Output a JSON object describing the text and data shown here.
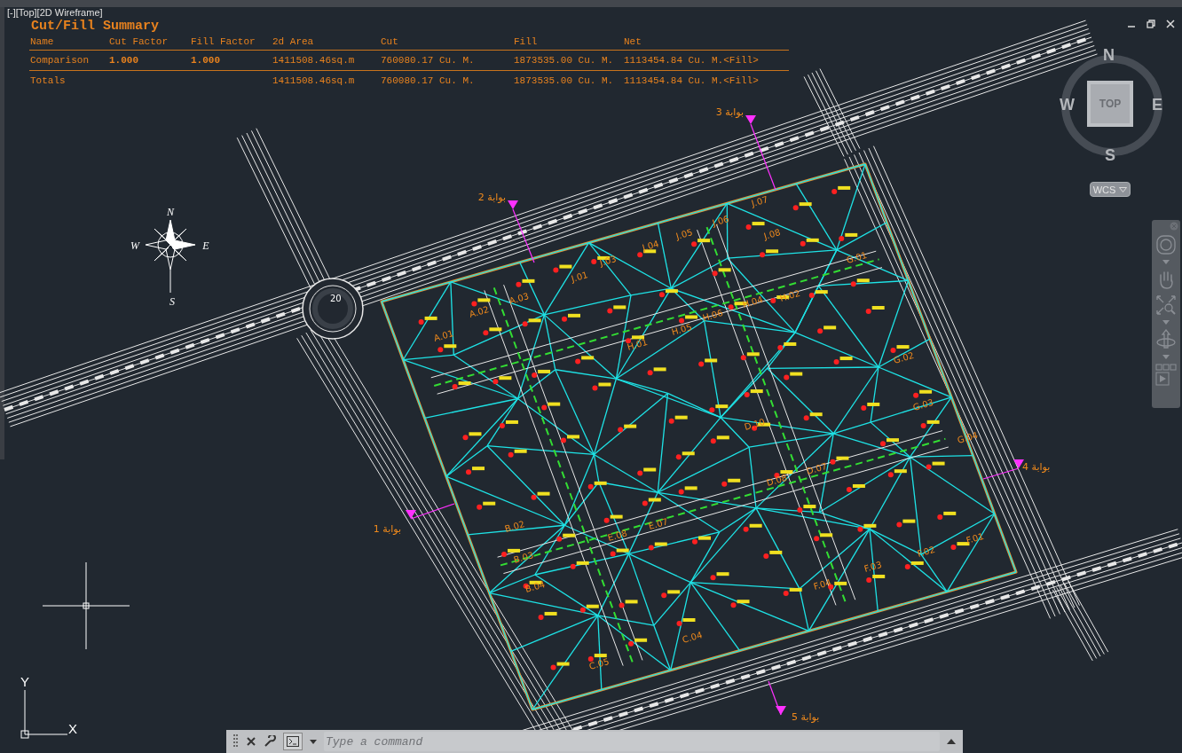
{
  "viewport_label": "[-][Top][2D Wireframe]",
  "summary": {
    "title": "Cut/Fill Summary",
    "columns": [
      "Name",
      "Cut Factor",
      "Fill Factor",
      "2d Area",
      "Cut",
      "Fill",
      "Net"
    ],
    "rows": [
      {
        "name": "Comparison",
        "cut_factor": "1.000",
        "fill_factor": "1.000",
        "area": "1411508.46sq.m",
        "cut": "760080.17 Cu. M.",
        "fill": "1873535.00 Cu. M.",
        "net": "1113454.84 Cu. M.<Fill>"
      },
      {
        "name": "Totals",
        "area": "1411508.46sq.m",
        "cut": "760080.17 Cu. M.",
        "fill": "1873535.00 Cu. M.",
        "net": "1113454.84 Cu. M.<Fill>"
      }
    ]
  },
  "viewcube": {
    "north": "N",
    "east": "E",
    "south": "S",
    "west": "W",
    "face": "TOP"
  },
  "coordinate_system": "WCS",
  "compass_rose": {
    "north": "N",
    "west": "W",
    "east": "E",
    "south": "S"
  },
  "roundabout_label": "20",
  "gates": [
    {
      "label": "1 بوابة"
    },
    {
      "label": "2 بوابة"
    },
    {
      "label": "3 بوابة"
    },
    {
      "label": "4 بوابة"
    },
    {
      "label": "5 بوابة"
    }
  ],
  "plots": [
    {
      "label": "A.01"
    },
    {
      "label": "A.02"
    },
    {
      "label": "A.03"
    },
    {
      "label": "J.01"
    },
    {
      "label": "J.03"
    },
    {
      "label": "J.04"
    },
    {
      "label": "J.05"
    },
    {
      "label": "J.06"
    },
    {
      "label": "J.07"
    },
    {
      "label": "J.08"
    },
    {
      "label": "H.01"
    },
    {
      "label": "H.02"
    },
    {
      "label": "H.04"
    },
    {
      "label": "H.05"
    },
    {
      "label": "H.06"
    },
    {
      "label": "G.01"
    },
    {
      "label": "G.02"
    },
    {
      "label": "G.03"
    },
    {
      "label": "G.04"
    },
    {
      "label": "F.01"
    },
    {
      "label": "F.02"
    },
    {
      "label": "F.03"
    },
    {
      "label": "F.04"
    },
    {
      "label": "E.07"
    },
    {
      "label": "E.08"
    },
    {
      "label": "D.07"
    },
    {
      "label": "D.08"
    },
    {
      "label": "D.10"
    },
    {
      "label": "C.04"
    },
    {
      "label": "C.05"
    },
    {
      "label": "B.02"
    },
    {
      "label": "B.03"
    },
    {
      "label": "B.04"
    }
  ],
  "ucs": {
    "x": "X",
    "y": "Y"
  },
  "command_line": {
    "placeholder": "Type a command"
  }
}
